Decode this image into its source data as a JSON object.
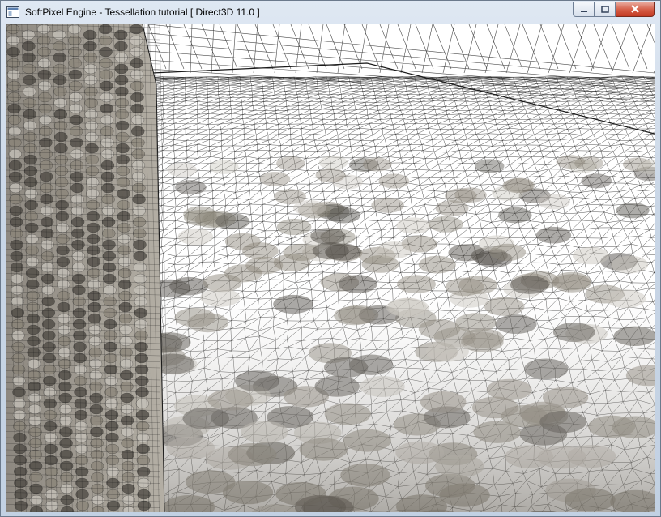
{
  "window": {
    "title": "SoftPixel Engine - Tessellation tutorial [ Direct3D 11.0 ]",
    "controls": {
      "minimize": "minimize",
      "maximize": "maximize",
      "close": "close"
    }
  },
  "viewport": {
    "scene": "tessellated-wireframe-room",
    "colors": {
      "wire": "#1a1a1a",
      "background": "#ffffff",
      "stone": "#8a8478",
      "stone_dark": "#4a4640",
      "stone_light": "#c8c4bc"
    }
  }
}
